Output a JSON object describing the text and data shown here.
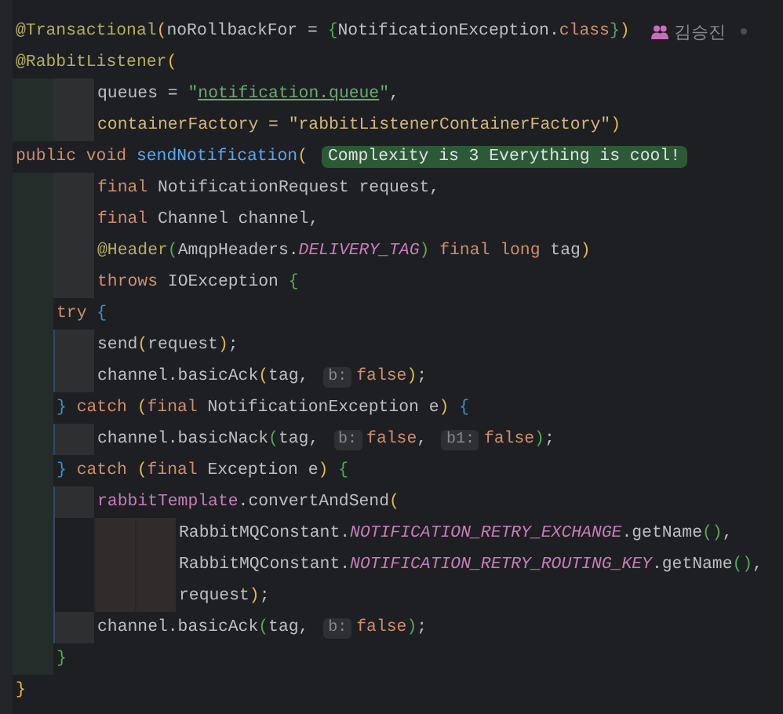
{
  "lines": [
    {
      "tokens": [
        {
          "kind": "annotation",
          "text": "@Transactional"
        },
        {
          "kind": "paren-yellow",
          "text": "("
        },
        {
          "kind": "plain",
          "text": "noRollbackFor = "
        },
        {
          "kind": "paren-green",
          "text": "{"
        },
        {
          "kind": "plain",
          "text": "NotificationException."
        },
        {
          "kind": "keyword",
          "text": "class"
        },
        {
          "kind": "paren-green",
          "text": "}"
        },
        {
          "kind": "paren-yellow",
          "text": ")"
        },
        {
          "kind": "author",
          "text": "김승진"
        }
      ]
    },
    {
      "tokens": [
        {
          "kind": "annotation",
          "text": "@RabbitListener"
        },
        {
          "kind": "paren-yellow",
          "text": "("
        }
      ]
    },
    {
      "guides": [
        {
          "kind": "green"
        },
        {
          "kind": "grey"
        }
      ],
      "tokens": [
        {
          "kind": "plain",
          "text": "queues = "
        },
        {
          "kind": "string",
          "text": "\""
        },
        {
          "kind": "link",
          "text": "notification.queue"
        },
        {
          "kind": "string",
          "text": "\""
        },
        {
          "kind": "plain",
          "text": ","
        }
      ]
    },
    {
      "guides": [
        {
          "kind": "green"
        },
        {
          "kind": "grey"
        }
      ],
      "tokens": [
        {
          "kind": "argument",
          "text": "containerFactory = \"rabbitListenerContainerFactory\""
        },
        {
          "kind": "paren-yellow",
          "text": ")"
        }
      ]
    },
    {
      "tokens": [
        {
          "kind": "keyword",
          "text": "public void "
        },
        {
          "kind": "declaration",
          "text": "sendNotification"
        },
        {
          "kind": "paren-yellow",
          "text": "("
        },
        {
          "kind": "badge",
          "text": "Complexity is 3 Everything is cool!"
        }
      ]
    },
    {
      "guides": [
        {
          "kind": "green"
        },
        {
          "kind": "grey"
        }
      ],
      "tokens": [
        {
          "kind": "keyword",
          "text": "final "
        },
        {
          "kind": "plain",
          "text": "NotificationRequest request,"
        }
      ]
    },
    {
      "guides": [
        {
          "kind": "green"
        },
        {
          "kind": "grey"
        }
      ],
      "tokens": [
        {
          "kind": "keyword",
          "text": "final "
        },
        {
          "kind": "plain",
          "text": "Channel channel,"
        }
      ]
    },
    {
      "guides": [
        {
          "kind": "green"
        },
        {
          "kind": "grey"
        }
      ],
      "tokens": [
        {
          "kind": "annotation",
          "text": "@Header"
        },
        {
          "kind": "paren-green",
          "text": "("
        },
        {
          "kind": "plain",
          "text": "AmqpHeaders."
        },
        {
          "kind": "constant",
          "text": "DELIVERY_TAG"
        },
        {
          "kind": "paren-green",
          "text": ")"
        },
        {
          "kind": "keyword",
          "text": " final long "
        },
        {
          "kind": "plain",
          "text": "tag"
        },
        {
          "kind": "paren-yellow",
          "text": ")"
        }
      ]
    },
    {
      "guides": [
        {
          "kind": "green"
        },
        {
          "kind": "grey"
        }
      ],
      "tokens": [
        {
          "kind": "keyword",
          "text": "throws "
        },
        {
          "kind": "plain",
          "text": "IOException "
        },
        {
          "kind": "paren-green",
          "text": "{"
        }
      ]
    },
    {
      "guides": [
        {
          "kind": "green"
        }
      ],
      "tokens": [
        {
          "kind": "keyword",
          "text": "try "
        },
        {
          "kind": "paren-blue",
          "text": "{"
        }
      ]
    },
    {
      "guides": [
        {
          "kind": "green"
        },
        {
          "kind": "scope"
        }
      ],
      "tokens": [
        {
          "kind": "plain",
          "text": "send"
        },
        {
          "kind": "paren-yellow",
          "text": "("
        },
        {
          "kind": "plain",
          "text": "request"
        },
        {
          "kind": "paren-yellow",
          "text": ")"
        },
        {
          "kind": "plain",
          "text": ";"
        }
      ]
    },
    {
      "guides": [
        {
          "kind": "green"
        },
        {
          "kind": "scope"
        }
      ],
      "tokens": [
        {
          "kind": "plain",
          "text": "channel.basicAck"
        },
        {
          "kind": "paren-yellow",
          "text": "("
        },
        {
          "kind": "plain",
          "text": "tag, "
        },
        {
          "kind": "hint",
          "text": "b:"
        },
        {
          "kind": "keyword",
          "text": "false"
        },
        {
          "kind": "paren-yellow",
          "text": ")"
        },
        {
          "kind": "plain",
          "text": ";"
        }
      ]
    },
    {
      "guides": [
        {
          "kind": "green"
        }
      ],
      "tokens": [
        {
          "kind": "paren-blue",
          "text": "}"
        },
        {
          "kind": "keyword",
          "text": " catch "
        },
        {
          "kind": "paren-yellow",
          "text": "("
        },
        {
          "kind": "keyword",
          "text": "final "
        },
        {
          "kind": "plain",
          "text": "NotificationException e"
        },
        {
          "kind": "paren-yellow",
          "text": ")"
        },
        {
          "kind": "paren-blue",
          "text": " {"
        }
      ]
    },
    {
      "guides": [
        {
          "kind": "green"
        },
        {
          "kind": "scope"
        }
      ],
      "tokens": [
        {
          "kind": "plain",
          "text": "channel.basicNack"
        },
        {
          "kind": "paren-green",
          "text": "("
        },
        {
          "kind": "plain",
          "text": "tag, "
        },
        {
          "kind": "hint",
          "text": "b:"
        },
        {
          "kind": "keyword",
          "text": "false"
        },
        {
          "kind": "plain",
          "text": ", "
        },
        {
          "kind": "hint",
          "text": "b1:"
        },
        {
          "kind": "keyword",
          "text": "false"
        },
        {
          "kind": "paren-green",
          "text": ")"
        },
        {
          "kind": "plain",
          "text": ";"
        }
      ]
    },
    {
      "guides": [
        {
          "kind": "green"
        }
      ],
      "tokens": [
        {
          "kind": "paren-blue",
          "text": "}"
        },
        {
          "kind": "keyword",
          "text": " catch "
        },
        {
          "kind": "paren-yellow",
          "text": "("
        },
        {
          "kind": "keyword",
          "text": "final "
        },
        {
          "kind": "plain",
          "text": "Exception e"
        },
        {
          "kind": "paren-yellow",
          "text": ")"
        },
        {
          "kind": "paren-green",
          "text": " {"
        }
      ]
    },
    {
      "guides": [
        {
          "kind": "green"
        },
        {
          "kind": "scope"
        }
      ],
      "tokens": [
        {
          "kind": "field",
          "text": "rabbitTemplate"
        },
        {
          "kind": "plain",
          "text": ".convertAndSend"
        },
        {
          "kind": "paren-yellow",
          "text": "("
        }
      ]
    },
    {
      "guides": [
        {
          "kind": "green"
        },
        {
          "kind": "scope-empty"
        },
        {
          "kind": "brown"
        },
        {
          "kind": "brown"
        }
      ],
      "tokens": [
        {
          "kind": "plain",
          "text": "RabbitMQConstant."
        },
        {
          "kind": "constant",
          "text": "NOTIFICATION_RETRY_EXCHANGE"
        },
        {
          "kind": "plain",
          "text": ".getName"
        },
        {
          "kind": "paren-green",
          "text": "()"
        },
        {
          "kind": "plain",
          "text": ","
        }
      ]
    },
    {
      "guides": [
        {
          "kind": "green"
        },
        {
          "kind": "scope-empty"
        },
        {
          "kind": "brown"
        },
        {
          "kind": "brown"
        }
      ],
      "tokens": [
        {
          "kind": "plain",
          "text": "RabbitMQConstant."
        },
        {
          "kind": "constant",
          "text": "NOTIFICATION_RETRY_ROUTING_KEY"
        },
        {
          "kind": "plain",
          "text": ".getName"
        },
        {
          "kind": "paren-green",
          "text": "()"
        },
        {
          "kind": "plain",
          "text": ","
        }
      ]
    },
    {
      "guides": [
        {
          "kind": "green"
        },
        {
          "kind": "scope-empty"
        },
        {
          "kind": "brown"
        },
        {
          "kind": "brown"
        }
      ],
      "tokens": [
        {
          "kind": "plain",
          "text": "request"
        },
        {
          "kind": "paren-yellow",
          "text": ")"
        },
        {
          "kind": "plain",
          "text": ";"
        }
      ]
    },
    {
      "guides": [
        {
          "kind": "green"
        },
        {
          "kind": "scope"
        }
      ],
      "tokens": [
        {
          "kind": "plain",
          "text": "channel.basicAck"
        },
        {
          "kind": "paren-green",
          "text": "("
        },
        {
          "kind": "plain",
          "text": "tag, "
        },
        {
          "kind": "hint",
          "text": "b:"
        },
        {
          "kind": "keyword",
          "text": "false"
        },
        {
          "kind": "paren-green",
          "text": ")"
        },
        {
          "kind": "plain",
          "text": ";"
        }
      ]
    },
    {
      "guides": [
        {
          "kind": "green"
        }
      ],
      "tokens": [
        {
          "kind": "paren-green",
          "text": "}"
        }
      ]
    },
    {
      "tokens": [
        {
          "kind": "paren-yellow",
          "text": "}"
        }
      ]
    }
  ]
}
